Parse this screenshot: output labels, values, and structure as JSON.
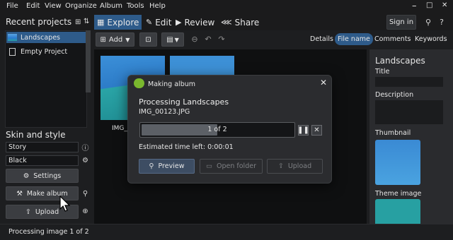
{
  "menubar": {
    "items": [
      "File",
      "Edit",
      "View",
      "Organize",
      "Album",
      "Tools",
      "Help"
    ]
  },
  "tabs": [
    {
      "label": "Explore",
      "icon": "grid-icon"
    },
    {
      "label": "Edit",
      "icon": "pencil-icon"
    },
    {
      "label": "Review",
      "icon": "play-icon"
    },
    {
      "label": "Share",
      "icon": "share-icon"
    }
  ],
  "header": {
    "signin_label": "Sign in"
  },
  "left": {
    "recent_title": "Recent projects",
    "projects": [
      "Landscapes",
      "Empty Project"
    ],
    "skin_title": "Skin and style",
    "skin_value": "Story",
    "style_value": "Black",
    "settings_label": "Settings",
    "make_album_label": "Make album",
    "upload_label": "Upload"
  },
  "toolbar": {
    "add_label": "Add",
    "panel_tabs": [
      "Details",
      "File name",
      "Comments",
      "Keywords"
    ],
    "active_panel_tab": "File name"
  },
  "gallery": {
    "items": [
      {
        "caption": "IMG_00123.JPG"
      }
    ]
  },
  "right": {
    "title": "Landscapes",
    "title_label": "Title",
    "description_label": "Description",
    "thumbnail_label": "Thumbnail",
    "theme_label": "Theme image"
  },
  "status": {
    "text": "Processing image 1 of 2"
  },
  "dialog": {
    "title": "Making album",
    "heading": "Processing Landscapes",
    "filename": "IMG_00123.JPG",
    "progress_text": "1 of 2",
    "progress_fraction": 0.5,
    "eta": "Estimated time left: 0:00:01",
    "preview_label": "Preview",
    "open_folder_label": "Open folder",
    "upload_label": "Upload"
  },
  "colors": {
    "accent": "#2e5b8a",
    "background": "#1d1e20",
    "panel": "#2b2c2f"
  }
}
